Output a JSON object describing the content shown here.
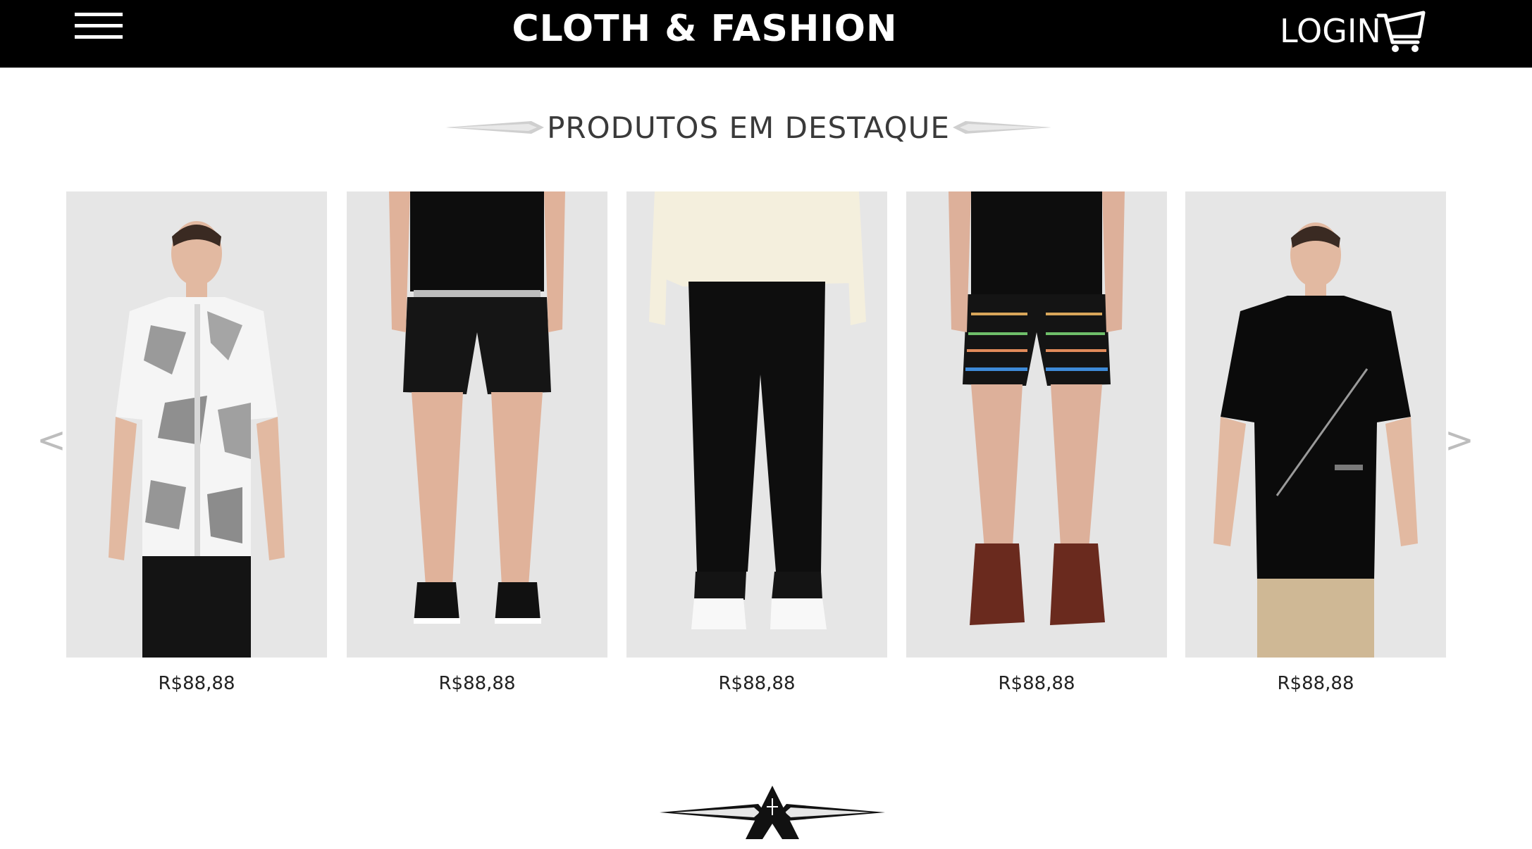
{
  "header": {
    "brand": "CLOTH & FASHION",
    "login_label": "LOGIN",
    "menu_icon": "hamburger-menu-icon",
    "cart_icon": "shopping-cart-icon"
  },
  "section": {
    "title": "PRODUTOS EM DESTAQUE"
  },
  "carousel": {
    "prev_label": "<",
    "next_label": ">",
    "products": [
      {
        "price": "R$88,88",
        "image": "man in white geometric print short-sleeve shirt and black pants"
      },
      {
        "price": "R$88,88",
        "image": "black shorts with black tee and black sneakers"
      },
      {
        "price": "R$88,88",
        "image": "black jogger pants with cream shirt and white sneakers"
      },
      {
        "price": "R$88,88",
        "image": "black shorts with colored stripes and brown boots"
      },
      {
        "price": "R$88,88",
        "image": "man in black t-shirt with diagonal line and beige pants"
      }
    ]
  },
  "colors": {
    "topbar": "#000000",
    "text_light": "#ffffff",
    "title_text": "#3a3a3a",
    "arrow": "#bdbdbd",
    "photo_bg": "#e7e7e7"
  }
}
